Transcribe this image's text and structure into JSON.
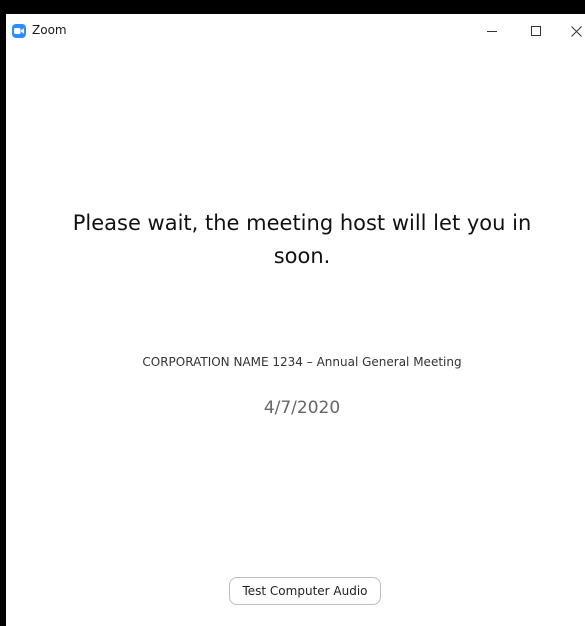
{
  "window": {
    "app_title": "Zoom",
    "app_icon": "zoom-camera-icon",
    "controls": [
      "minimize-icon",
      "maximize-icon",
      "close-icon"
    ]
  },
  "main": {
    "wait_message": "Please wait, the meeting host will let you in soon.",
    "meeting_name": "CORPORATION NAME 1234 – Annual General Meeting",
    "meeting_date": "4/7/2020",
    "test_audio_label": "Test Computer Audio"
  },
  "colors": {
    "brand": "#2d8cff",
    "background": "#ffffff",
    "frame": "#000000"
  }
}
